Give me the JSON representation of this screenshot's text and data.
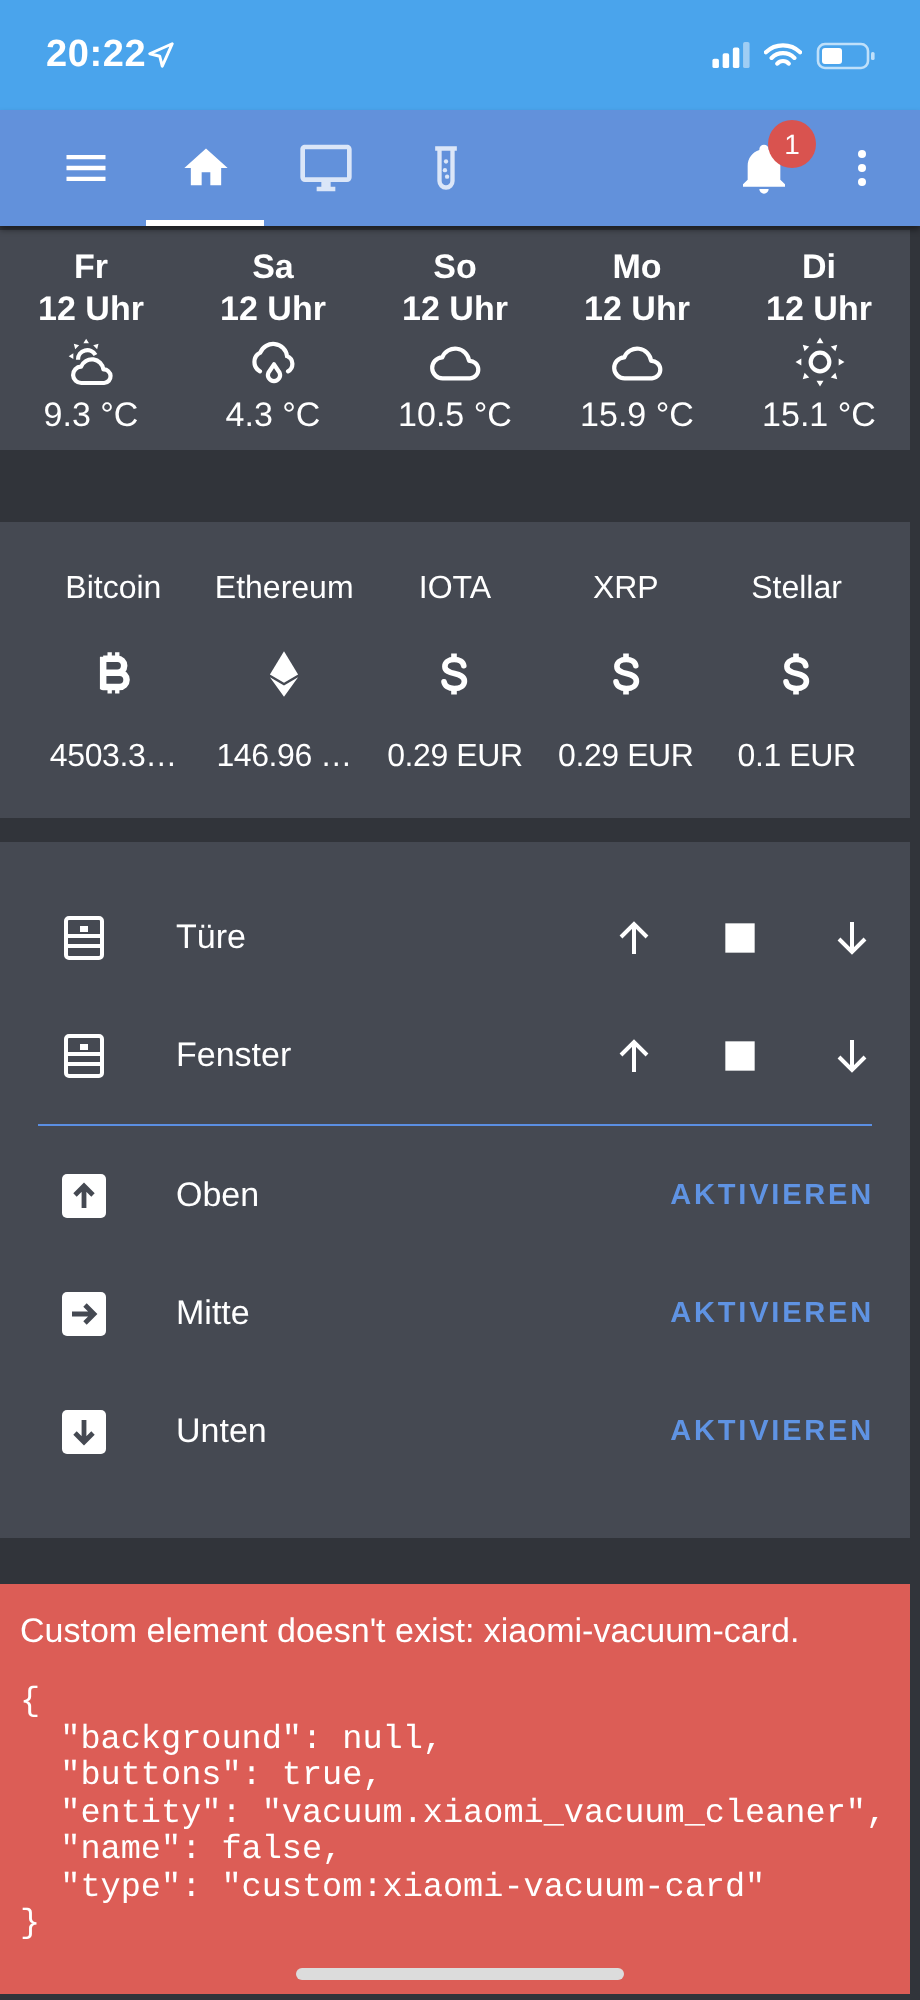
{
  "status_bar": {
    "time": "20:22"
  },
  "toolbar": {
    "tabs": [
      {
        "kind": "home",
        "selected": true
      },
      {
        "kind": "monitor",
        "selected": false
      },
      {
        "kind": "test-tube",
        "selected": false
      }
    ],
    "notification_badge": "1"
  },
  "weather": [
    {
      "day": "Fr",
      "time": "12 Uhr",
      "kind": "partlycloudy",
      "temperature": "9.3 °C"
    },
    {
      "day": "Sa",
      "time": "12 Uhr",
      "kind": "rainy",
      "temperature": "4.3 °C"
    },
    {
      "day": "So",
      "time": "12 Uhr",
      "kind": "cloudy",
      "temperature": "10.5 °C"
    },
    {
      "day": "Mo",
      "time": "12 Uhr",
      "kind": "cloudy",
      "temperature": "15.9 °C"
    },
    {
      "day": "Di",
      "time": "12 Uhr",
      "kind": "sunny",
      "temperature": "15.1 °C"
    }
  ],
  "crypto": [
    {
      "name": "Bitcoin",
      "kind": "bitcoin",
      "price": "4503.3…"
    },
    {
      "name": "Ethereum",
      "kind": "ethereum",
      "price": "146.96 …"
    },
    {
      "name": "IOTA",
      "kind": "dollar",
      "price": "0.29 EUR"
    },
    {
      "name": "XRP",
      "kind": "dollar",
      "price": "0.29 EUR"
    },
    {
      "name": "Stellar",
      "kind": "dollar",
      "price": "0.1 EUR"
    }
  ],
  "covers": [
    {
      "name": "Türe"
    },
    {
      "name": "Fenster"
    }
  ],
  "scenes": [
    {
      "name": "Oben",
      "kind": "up",
      "action": "AKTIVIEREN"
    },
    {
      "name": "Mitte",
      "kind": "right",
      "action": "AKTIVIEREN"
    },
    {
      "name": "Unten",
      "kind": "down",
      "action": "AKTIVIEREN"
    }
  ],
  "error": {
    "message": "Custom element doesn't exist: xiaomi-vacuum-card.",
    "code": [
      "{",
      "  \"background\": null,",
      "  \"buttons\": true,",
      "  \"entity\": \"vacuum.xiaomi_vacuum_cleaner\",",
      "  \"name\": false,",
      "  \"type\": \"custom:xiaomi-vacuum-card\"",
      "}"
    ]
  }
}
